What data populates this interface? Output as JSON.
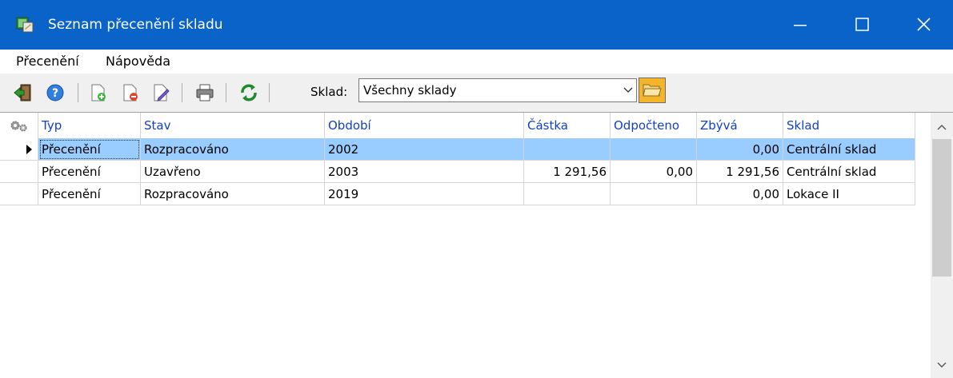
{
  "window": {
    "title": "Seznam přecenění skladu",
    "title_bar_color": "#0a63c9"
  },
  "menu": [
    {
      "label": "Přecenění"
    },
    {
      "label": "Nápověda"
    }
  ],
  "toolbar": {
    "icons": [
      "exit-icon",
      "help-icon",
      "new-document-icon",
      "delete-document-icon",
      "edit-document-icon",
      "print-icon",
      "refresh-icon"
    ],
    "sklad_label": "Sklad:",
    "sklad_value": "Všechny sklady"
  },
  "grid": {
    "columns": [
      "Typ",
      "Stav",
      "Období",
      "Částka",
      "Odpočteno",
      "Zbývá",
      "Sklad"
    ],
    "header_text_color": "#1440c8",
    "selection_color": "#99ccff",
    "rows": [
      {
        "typ": "Přecenění",
        "stav": "Rozpracováno",
        "obdobi": "2002",
        "castka": "",
        "odpocteno": "",
        "zbyva": "0,00",
        "sklad": "Centrální sklad",
        "selected": true
      },
      {
        "typ": "Přecenění",
        "stav": "Uzavřeno",
        "obdobi": "2003",
        "castka": "1 291,56",
        "odpocteno": "0,00",
        "zbyva": "1 291,56",
        "sklad": "Centrální sklad",
        "selected": false
      },
      {
        "typ": "Přecenění",
        "stav": "Rozpracováno",
        "obdobi": "2019",
        "castka": "",
        "odpocteno": "",
        "zbyva": "0,00",
        "sklad": "Lokace II",
        "selected": false
      }
    ]
  }
}
